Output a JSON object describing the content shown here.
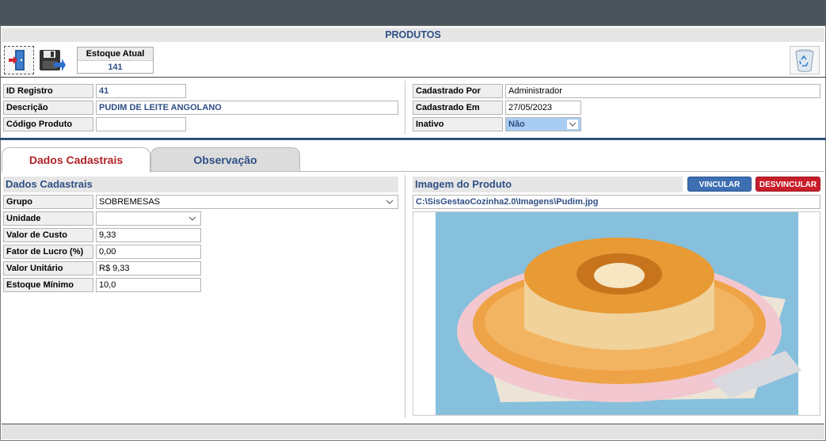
{
  "window": {
    "title": "PRODUTOS"
  },
  "toolbar": {
    "exit_icon": "exit-door-icon",
    "save_icon": "save-disk-icon",
    "delete_icon": "recycle-bin-icon",
    "estoque_label": "Estoque Atual",
    "estoque_value": "141"
  },
  "header": {
    "id_label": "ID Registro",
    "id_value": "41",
    "descricao_label": "Descrição",
    "descricao_value": "PUDIM DE LEITE ANGOLANO",
    "codigo_label": "Código Produto",
    "codigo_value": "",
    "cad_por_label": "Cadastrado Por",
    "cad_por_value": "Administrador",
    "cad_em_label": "Cadastrado Em",
    "cad_em_value": "27/05/2023",
    "inativo_label": "Inativo",
    "inativo_value": "Não"
  },
  "tabs": [
    {
      "label": "Dados Cadastrais",
      "active": true
    },
    {
      "label": "Observação",
      "active": false
    }
  ],
  "dados": {
    "title": "Dados Cadastrais",
    "grupo_label": "Grupo",
    "grupo_value": "SOBREMESAS",
    "unidade_label": "Unidade",
    "unidade_value": "",
    "custo_label": "Valor de Custo",
    "custo_value": "9,33",
    "lucro_label": "Fator de Lucro (%)",
    "lucro_value": "0,00",
    "unitario_label": "Valor Unitário",
    "unitario_value": "R$ 9,33",
    "minimo_label": "Estoque Mínimo",
    "minimo_value": "10,0"
  },
  "imagem": {
    "title": "Imagem do Produto",
    "vincular_label": "VINCULAR",
    "desvincular_label": "DESVINCULAR",
    "path": "C:\\SisGestaoCozinha2.0\\Imagens\\Pudim.jpg"
  },
  "colors": {
    "accent_blue": "#2f4f85",
    "accent_red": "#b02228",
    "titlebar": "#4a545b"
  }
}
